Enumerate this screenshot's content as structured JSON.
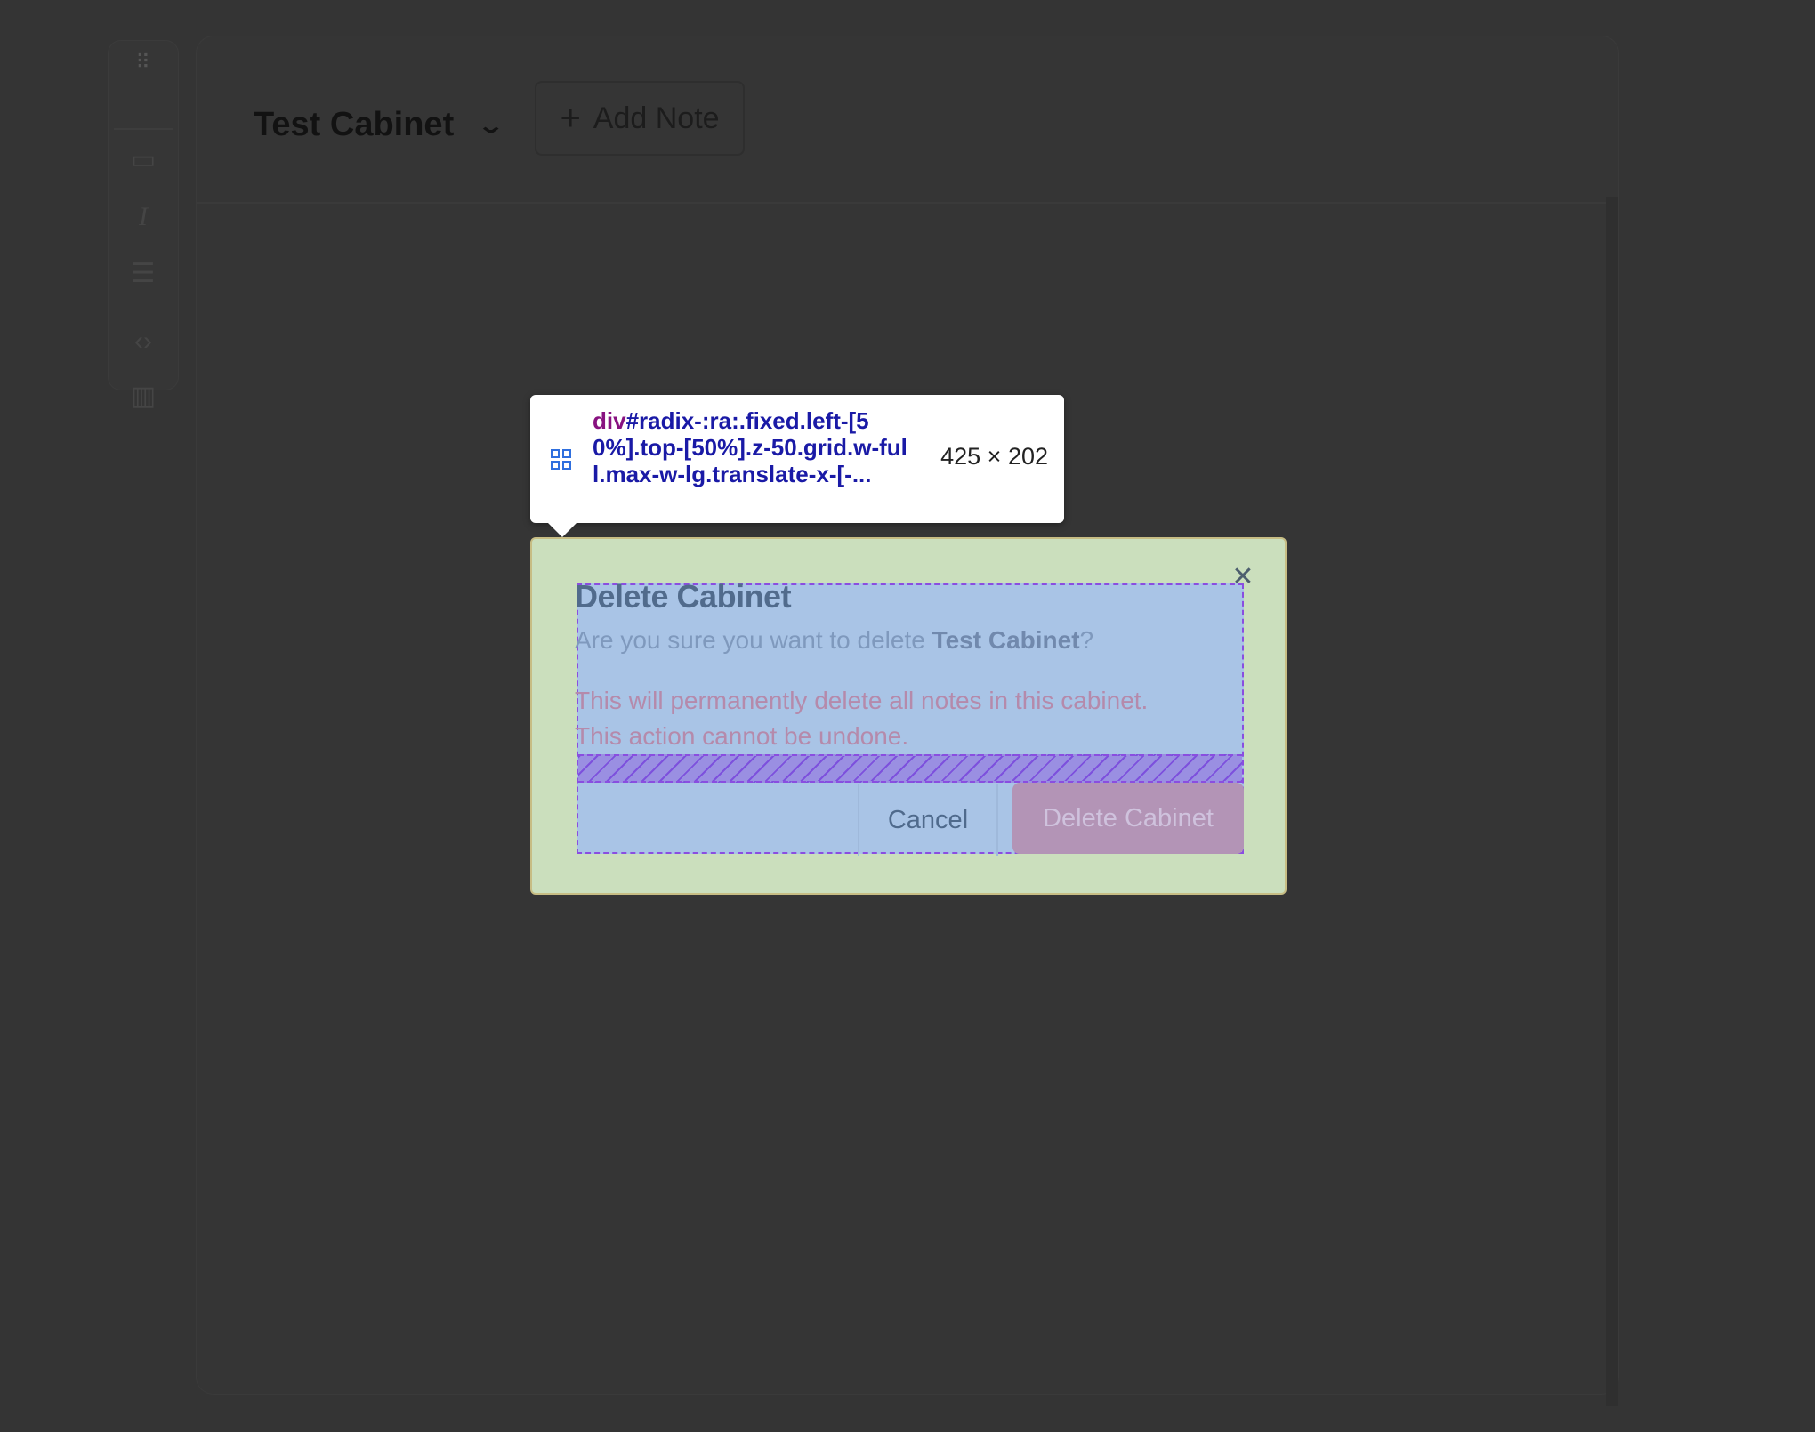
{
  "toolbar": {
    "grip_icon": "drag-handle-icon",
    "tools": [
      "note-icon",
      "italic-icon",
      "list-icon",
      "code-icon",
      "columns-icon"
    ]
  },
  "header": {
    "cabinet_name": "Test Cabinet",
    "add_note_label": "Add Note"
  },
  "inspector": {
    "selector_tag": "div",
    "selector_rest": "#radix-:ra:.fixed.left-[50%].top-[50%].z-50.grid.w-full.max-w-lg.translate-x-[-...",
    "dimensions": "425 × 202"
  },
  "dialog": {
    "title": "Delete Cabinet",
    "desc_prefix": "Are you sure you want to delete ",
    "desc_target": "Test Cabinet",
    "desc_suffix": "?",
    "warning_line1": "This will permanently delete all notes in this cabinet.",
    "warning_line2": "This action cannot be undone.",
    "cancel_label": "Cancel",
    "confirm_label": "Delete Cabinet"
  },
  "colors": {
    "backdrop": "#343434",
    "overlay_margin": "#cbdfbd",
    "overlay_content": "#a9c4e6",
    "overlay_gap": "#9a8fe2",
    "selector_tag": "#881280",
    "selector_text": "#1a1aa6"
  }
}
